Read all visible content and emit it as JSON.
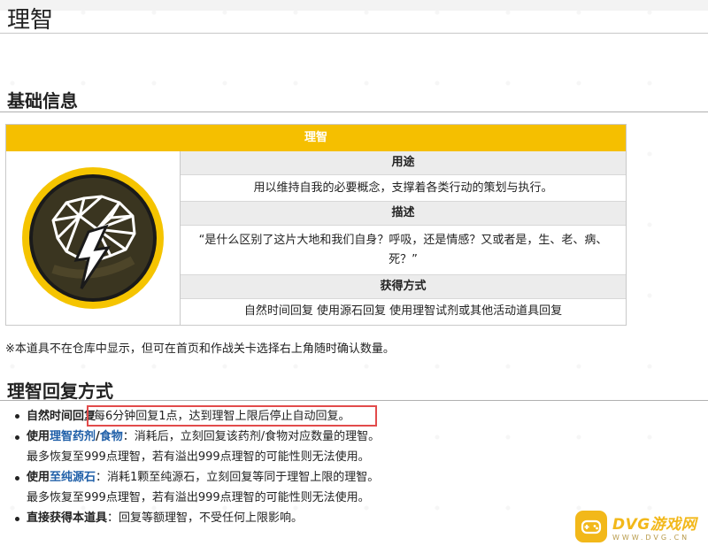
{
  "page": {
    "title": "理智"
  },
  "basic_info": {
    "section_title": "基础信息",
    "table_title": "理智",
    "usage_header": "用途",
    "usage_text": "用以维持自我的必要概念，支撑着各类行动的策划与执行。",
    "desc_header": "描述",
    "desc_text": "“是什么区别了这片大地和我们自身？呼吸，还是情感？又或者是，生、老、病、死？”",
    "obtain_header": "获得方式",
    "obtain_text": "自然时间回复 使用源石回复 使用理智试剂或其他活动道具回复",
    "icon": "brain-lightning-icon",
    "note": "※本道具不在仓库中显示，但可在首页和作战关卡选择右上角随时确认数量。"
  },
  "recovery": {
    "section_title": "理智回复方式",
    "items": [
      {
        "label": "自然时间回复",
        "text": "每6分钟回复1点，达到理智上限后停止自动回复。"
      },
      {
        "prefix": "使用",
        "link1": "理智药剂",
        "sep": "/",
        "link2": "食物",
        "text": "：消耗后，立刻回复该药剂/食物对应数量的理智。",
        "sub": "最多恢复至999点理智，若有溢出999点理智的可能性则无法使用。"
      },
      {
        "prefix": "使用",
        "link1": "至纯源石",
        "text": "：消耗1颗至纯源石，立刻回复等同于理智上限的理智。",
        "sub": "最多恢复至999点理智，若有溢出999点理智的可能性则无法使用。"
      },
      {
        "label": "直接获得本道具",
        "text": "：回复等额理智，不受任何上限影响。"
      }
    ]
  },
  "watermark": {
    "main": "DVG游戏网",
    "sub": "WWW.DVG.CN",
    "color": "#f2b81a"
  },
  "colors": {
    "header_yellow": "#f5bf00",
    "link_blue": "#1f5fa8",
    "highlight_red": "#e24b4b"
  }
}
